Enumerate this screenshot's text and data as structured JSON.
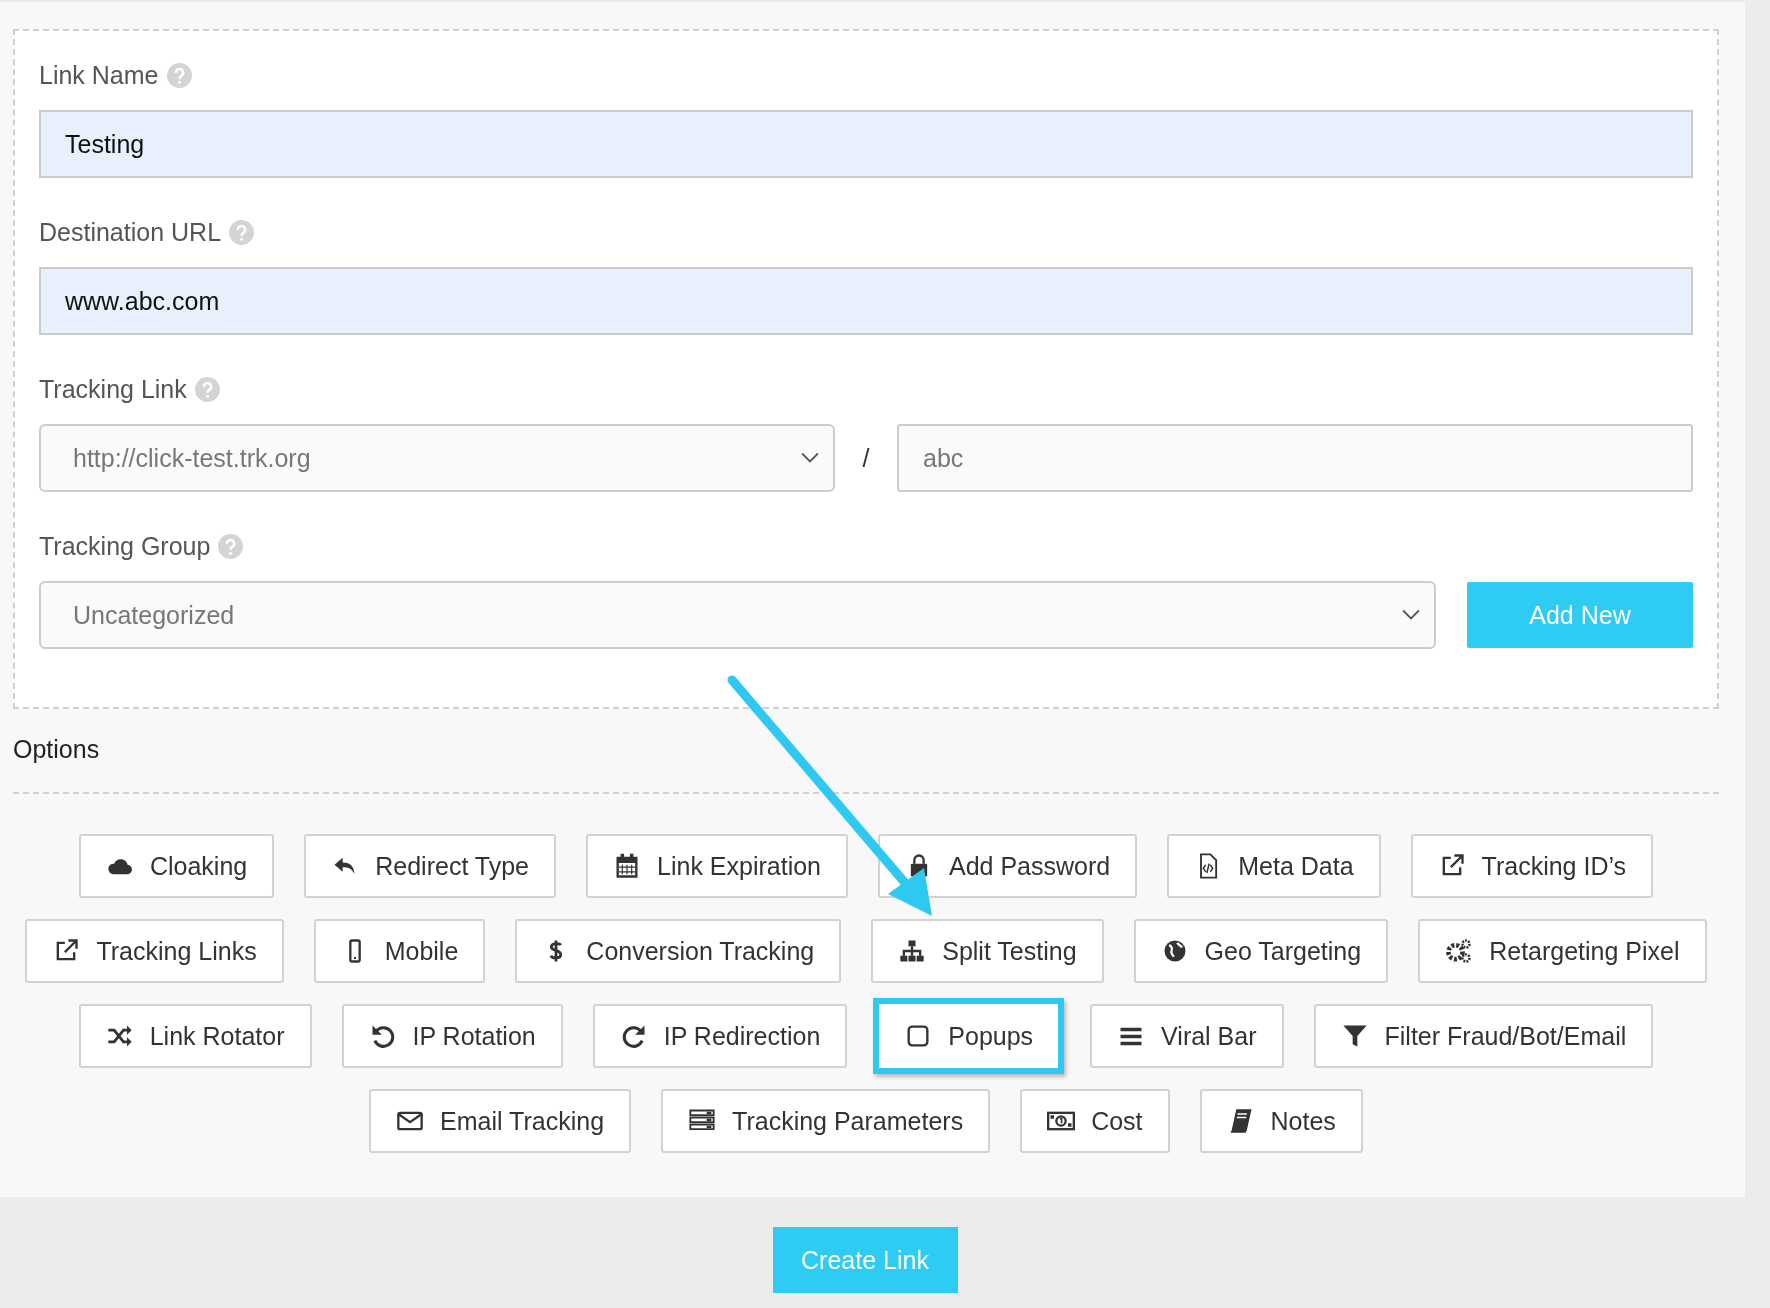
{
  "fields": [
    {
      "label": "Link Name",
      "value": "Testing"
    },
    {
      "label": "Destination URL",
      "value": "www.abc.com"
    }
  ],
  "tracking_link": {
    "label": "Tracking Link",
    "domain": "http://click-test.trk.org",
    "separator": "/",
    "slug": "abc"
  },
  "tracking_group": {
    "label": "Tracking Group",
    "value": "Uncategorized",
    "button": "Add New"
  },
  "options_title": "Options",
  "option_rows": [
    [
      {
        "label": "Cloaking",
        "highlighted": false
      },
      {
        "label": "Redirect Type",
        "highlighted": false
      },
      {
        "label": "Link Expiration",
        "highlighted": false
      },
      {
        "label": "Add Password",
        "highlighted": false
      },
      {
        "label": "Meta Data",
        "highlighted": false
      },
      {
        "label": "Tracking ID’s",
        "highlighted": false
      }
    ],
    [
      {
        "label": "Tracking Links",
        "highlighted": false
      },
      {
        "label": "Mobile",
        "highlighted": false
      },
      {
        "label": "Conversion Tracking",
        "highlighted": false
      },
      {
        "label": "Split Testing",
        "highlighted": false
      },
      {
        "label": "Geo Targeting",
        "highlighted": false
      },
      {
        "label": "Retargeting Pixel",
        "highlighted": false
      }
    ],
    [
      {
        "label": "Link Rotator",
        "highlighted": false
      },
      {
        "label": "IP Rotation",
        "highlighted": false
      },
      {
        "label": "IP Redirection",
        "highlighted": false
      },
      {
        "label": "Popups",
        "highlighted": true
      },
      {
        "label": "Viral Bar",
        "highlighted": false
      },
      {
        "label": "Filter Fraud/Bot/Email",
        "highlighted": false
      }
    ],
    [
      {
        "label": "Email Tracking",
        "highlighted": false
      },
      {
        "label": "Tracking Parameters",
        "highlighted": false
      },
      {
        "label": "Cost",
        "highlighted": false
      },
      {
        "label": "Notes",
        "highlighted": false
      }
    ]
  ],
  "submit": "Create Link"
}
